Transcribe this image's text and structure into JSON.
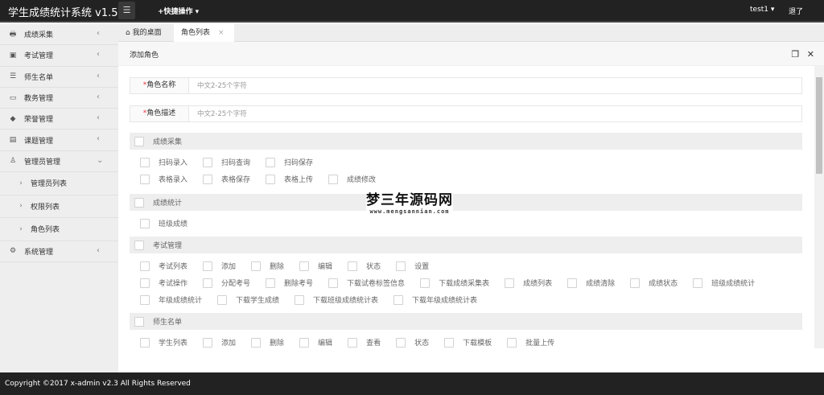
{
  "header": {
    "title": "学生成绩统计系统 v1.5",
    "quick_ops": "+快捷操作 ▾",
    "user": "test1 ▾",
    "logout": "退了"
  },
  "sidebar": {
    "items": [
      {
        "label": "成绩采集",
        "icon": "🖶",
        "name": "printer-icon"
      },
      {
        "label": "考试管理",
        "icon": "▣",
        "name": "exam-icon"
      },
      {
        "label": "师生名单",
        "icon": "☰",
        "name": "list-icon"
      },
      {
        "label": "教务管理",
        "icon": "▭",
        "name": "monitor-icon"
      },
      {
        "label": "荣誉管理",
        "icon": "◆",
        "name": "gem-icon"
      },
      {
        "label": "课题管理",
        "icon": "▤",
        "name": "board-icon"
      },
      {
        "label": "管理员管理",
        "icon": "♙",
        "name": "user-icon",
        "expanded": true
      },
      {
        "label": "管理员列表",
        "sub": true
      },
      {
        "label": "权限列表",
        "sub": true
      },
      {
        "label": "角色列表",
        "sub": true
      },
      {
        "label": "系统管理",
        "icon": "⚙",
        "name": "gear-icon"
      }
    ]
  },
  "tabs": [
    {
      "label": "我的桌面"
    },
    {
      "label": "角色列表"
    }
  ],
  "panel": {
    "title": "添加角色"
  },
  "form": {
    "name_label": "角色名称",
    "name_placeholder": "中文2-25个字符",
    "desc_label": "角色描述",
    "desc_placeholder": "中文2-25个字符"
  },
  "groups": [
    {
      "title": "成绩采集",
      "rows": [
        [
          "扫码录入",
          "扫码查询",
          "扫码保存"
        ],
        [
          "表格录入",
          "表格保存",
          "表格上传",
          "成绩修改"
        ]
      ]
    },
    {
      "title": "成绩统计",
      "rows": [
        [
          "班级成绩"
        ]
      ]
    },
    {
      "title": "考试管理",
      "rows": [
        [
          "考试列表",
          "添加",
          "删除",
          "编辑",
          "状态",
          "设置"
        ],
        [
          "考试操作",
          "分配考号",
          "删除考号",
          "下载试卷标签信息",
          "下载成绩采集表",
          "成绩列表",
          "成绩清除",
          "成绩状态",
          "班级成绩统计"
        ],
        [
          "年级成绩统计",
          "下载学生成绩",
          "下载班级成绩统计表",
          "下载年级成绩统计表"
        ]
      ]
    },
    {
      "title": "师生名单",
      "rows": [
        [
          "学生列表",
          "添加",
          "删除",
          "编辑",
          "查看",
          "状态",
          "下载模板",
          "批量上传"
        ]
      ]
    }
  ],
  "watermark": {
    "text": "梦三年源码网",
    "url": "www.mengsannian.com"
  },
  "footer": {
    "text": "Copyright ©2017 x-admin v2.3 All Rights Reserved"
  }
}
